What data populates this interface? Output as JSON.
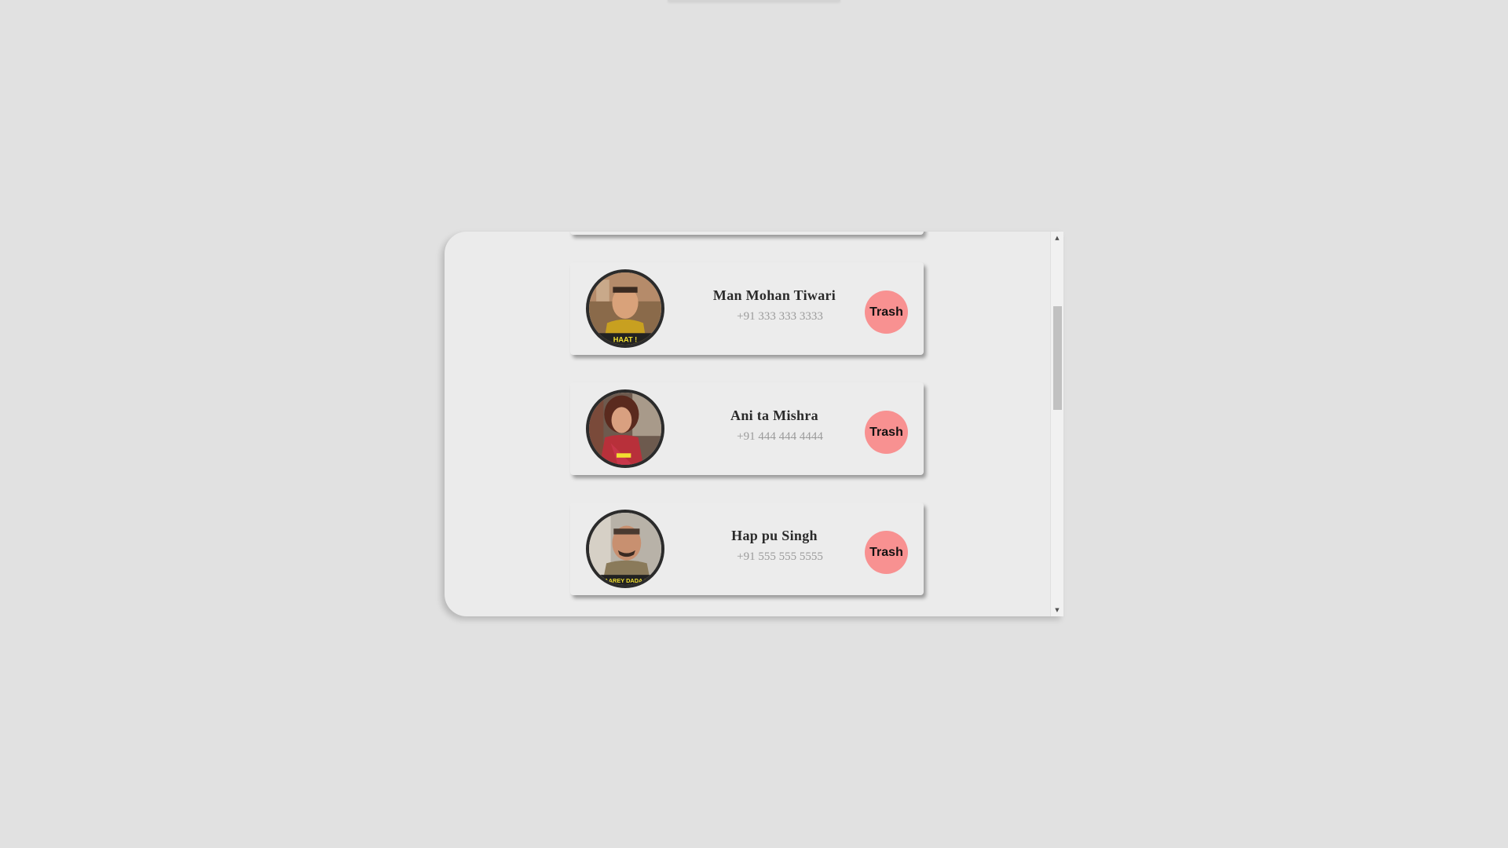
{
  "contacts": [
    {
      "name": "Man Mohan Tiwari",
      "phone": "+91 333 333 3333",
      "trash_label": "Trash",
      "avatar_icon": "portrait-man-yellow-shirt",
      "avatar_caption": "HAAT !"
    },
    {
      "name": "Ani ta Mishra",
      "phone": "+91 444 444 4444",
      "trash_label": "Trash",
      "avatar_icon": "portrait-woman-red-saree"
    },
    {
      "name": "Hap pu Singh",
      "phone": "+91 555 555 5555",
      "trash_label": "Trash",
      "avatar_icon": "portrait-policeman",
      "avatar_caption": "AAREY DADA !"
    }
  ],
  "scrollbar": {
    "up_icon": "▲",
    "down_icon": "▼"
  },
  "colors": {
    "page_bg": "#e1e1e1",
    "panel_bg": "#ebebeb",
    "trash_button": "#f89191"
  }
}
